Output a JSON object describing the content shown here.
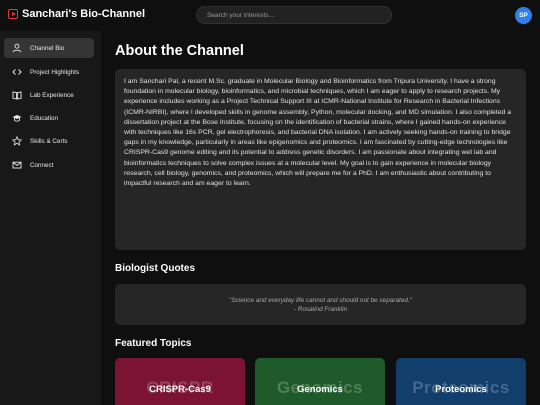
{
  "app": {
    "title": "Sanchari's Bio-Channel"
  },
  "search": {
    "placeholder": "Search your interests..."
  },
  "user": {
    "initials": "SP"
  },
  "sidebar": {
    "items": [
      {
        "label": "Channel Bio",
        "icon": "user-icon",
        "active": true
      },
      {
        "label": "Project Highlights",
        "icon": "code-icon",
        "active": false
      },
      {
        "label": "Lab Experience",
        "icon": "book-icon",
        "active": false
      },
      {
        "label": "Education",
        "icon": "graduation-cap-icon",
        "active": false
      },
      {
        "label": "Skills & Certs",
        "icon": "star-icon",
        "active": false
      },
      {
        "label": "Connect",
        "icon": "envelope-icon",
        "active": false
      }
    ]
  },
  "main": {
    "about_title": "About the Channel",
    "bio": "I am Sanchari Pal, a recent M.Sc. graduate in Molecular Biology and Bioinformatics from Tripura University. I have a strong foundation in molecular biology, bioinformatics, and microbial techniques, which I am eager to apply to research projects. My experience includes working as a Project Technical Support III at ICMR-National Institute for Research in Bacterial Infections (ICMR-NIRBI), where I developed skills in genome assembly, Python, molecular docking, and MD simulation. I also completed a dissertation project at the Bose Institute, focusing on the identification of bacterial strains, where I gained hands-on experience with techniques like 16s PCR, gel electrophoresis, and bacterial DNA isolation. I am actively seeking hands-on training to bridge gaps in my knowledge, particularly in areas like epigenomics and proteomics. I am fascinated by cutting-edge technologies like CRISPR-Cas9 genome editing and its potential to address genetic disorders. I am passionate about integrating wet lab and bioinformatics techniques to solve complex issues at a molecular level. My goal is to gain experience in molecular biology research, cell biology, genomics, and proteomics, which will prepare me for a PhD. I am enthusiastic about contributing to impactful research and am eager to learn.",
    "quotes_title": "Biologist Quotes",
    "quote": {
      "text": "\"Science and everyday life cannot and should not be separated.\"",
      "author": "- Rosalind Franklin"
    },
    "topics_title": "Featured Topics",
    "topics": [
      {
        "label": "CRISPR-Cas9",
        "ghost": "CRISPR",
        "color": "#7a1432"
      },
      {
        "label": "Genomics",
        "ghost": "Genomics",
        "color": "#1f5a2a"
      },
      {
        "label": "Proteomics",
        "ghost": "Proteomics",
        "color": "#123e6b"
      }
    ]
  },
  "colors": {
    "accent": "#2f80ed",
    "brand": "#e53935",
    "card": "#262626",
    "active_nav": "#353535"
  }
}
